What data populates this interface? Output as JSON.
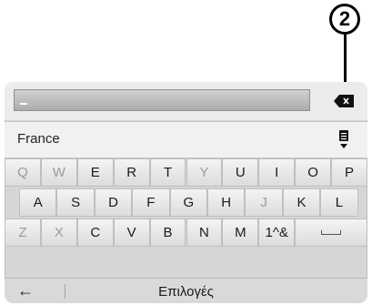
{
  "callout": {
    "number": "2"
  },
  "input": {
    "value": "_"
  },
  "country": {
    "label": "France"
  },
  "keyboard": {
    "row1": [
      "Q",
      "W",
      "E",
      "R",
      "T",
      "Y",
      "U",
      "I",
      "O",
      "P"
    ],
    "row1_dim": [
      true,
      true,
      false,
      false,
      false,
      true,
      false,
      false,
      false,
      false
    ],
    "row2": [
      "A",
      "S",
      "D",
      "F",
      "G",
      "H",
      "J",
      "K",
      "L"
    ],
    "row2_dim": [
      false,
      false,
      false,
      false,
      false,
      false,
      true,
      false,
      false
    ],
    "row3": [
      "Z",
      "X",
      "C",
      "V",
      "B",
      "N",
      "M",
      "1^&",
      ""
    ],
    "row3_dim": [
      true,
      true,
      false,
      false,
      false,
      false,
      false,
      false,
      false
    ]
  },
  "bottom": {
    "back_icon": "arrow-left-icon",
    "options_label": "Επιλογές"
  },
  "colors": {
    "screen_bg": "#d6d6d6",
    "key_text": "#1a1a1a",
    "dim_key_text": "#9b9b9b"
  }
}
